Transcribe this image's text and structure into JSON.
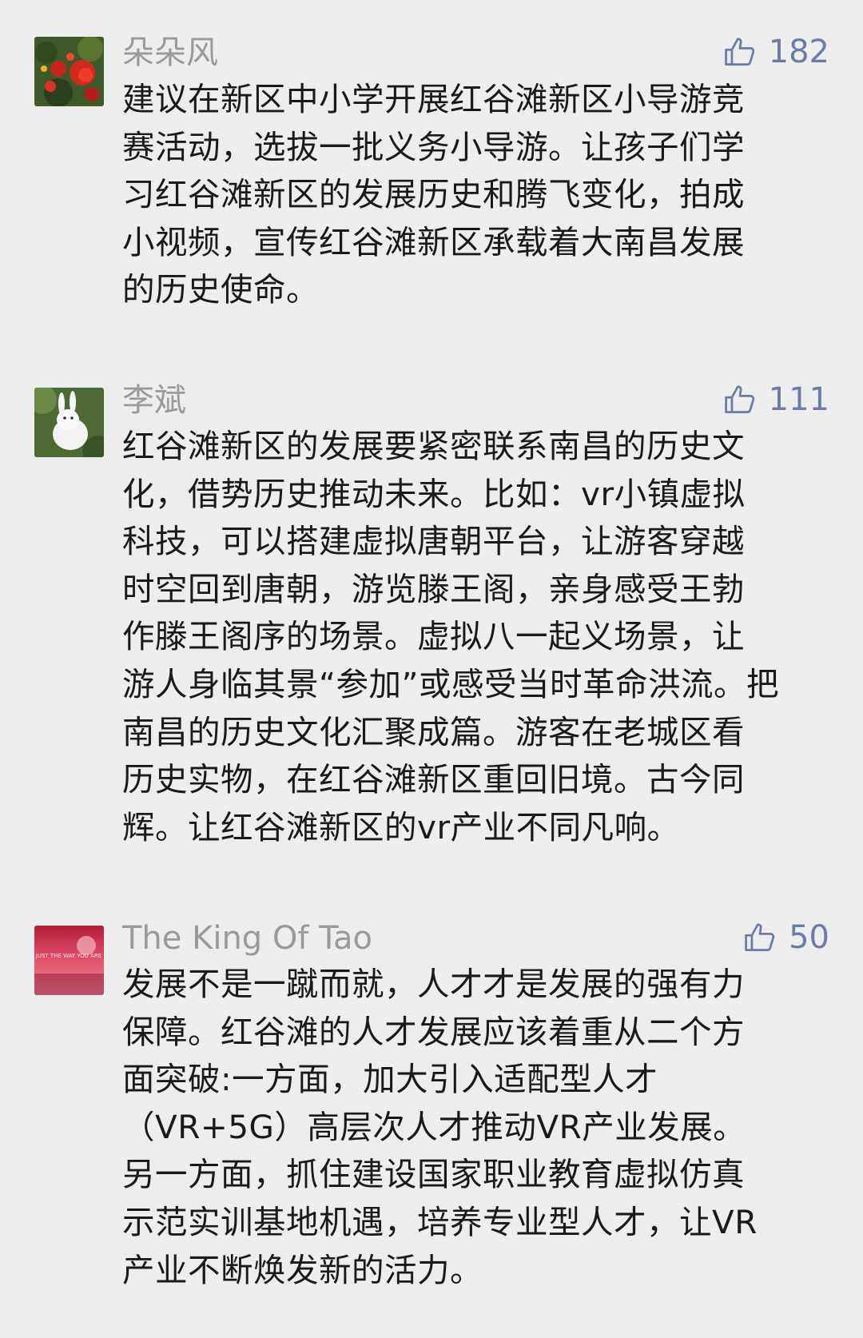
{
  "comments": [
    {
      "username": "朵朵风",
      "likes": "182",
      "avatar_icon": "red-flowers-avatar",
      "text": "建议在新区中小学开展红谷滩新区小导游竞\n赛活动，选拔一批义务小导游。让孩子们学\n习红谷滩新区的发展历史和腾飞变化，拍成\n小视频，宣传红谷滩新区承载着大南昌发展\n的历史使命。"
    },
    {
      "username": "李斌",
      "likes": "111",
      "avatar_icon": "white-rabbit-avatar",
      "text": "红谷滩新区的发展要紧密联系南昌的历史文\n化，借势历史推动未来。比如：vr小镇虚拟\n科技，可以搭建虚拟唐朝平台，让游客穿越\n时空回到唐朝，游览滕王阁，亲身感受王勃\n作滕王阁序的场景。虚拟八一起义场景，让\n游人身临其景“参加”或感受当时革命洪流。把\n南昌的历史文化汇聚成篇。游客在老城区看\n历史实物，在红谷滩新区重回旧境。古今同\n辉。让红谷滩新区的vr产业不同凡响。"
    },
    {
      "username": "The King Of Tao",
      "likes": "50",
      "avatar_icon": "pink-sunset-avatar",
      "avatar_caption": "JUST THE WAY YOU ARE",
      "text": "发展不是一蹴而就，人才才是发展的强有力\n保障。红谷滩的人才发展应该着重从二个方\n面突破:一方面，加大引入适配型人才\n（VR+5G）高层次人才推动VR产业发展。\n另一方面，抓住建设国家职业教育虚拟仿真\n示范实训基地机遇，培养专业型人才，让VR\n产业不断焕发新的活力。"
    }
  ],
  "colors": {
    "background": "#ededed",
    "username": "#9a9a9a",
    "like": "#6b7da6",
    "text": "#1a1a1a"
  }
}
